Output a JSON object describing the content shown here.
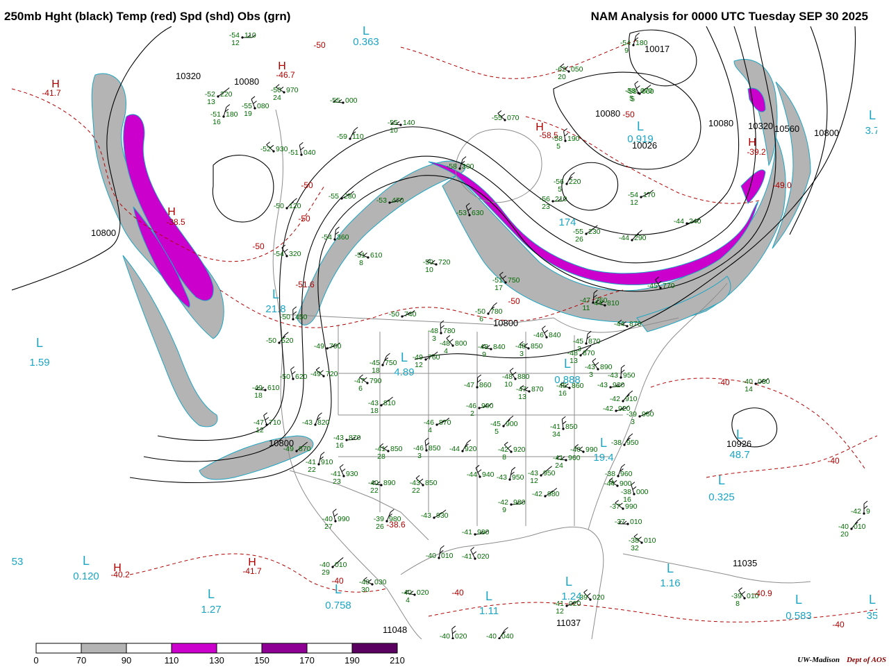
{
  "header": {
    "left_title": "250mb Hght (black) Temp (red) Spd (shd) Obs (grn)",
    "right_title": "NAM Analysis for 0000 UTC Tuesday  SEP 30 2025"
  },
  "colors": {
    "height_contour": "#000000",
    "temperature_contour": "#b00000",
    "boundaries": "#8c8c8c",
    "obs": "#006b00",
    "pressure_center_low": "#1ba5c4",
    "pressure_center_high": "#b00000",
    "speed_70_90": "#b4b4b4",
    "speed_110_130": "#cc00cc",
    "speed_150_170": "#8e0094",
    "speed_190_210": "#5a0060"
  },
  "legend": {
    "tick_labels": [
      "0",
      "70",
      "90",
      "110",
      "130",
      "150",
      "170",
      "190",
      "210"
    ],
    "bins": [
      {
        "from": 0,
        "to": 70,
        "color": "#ffffff"
      },
      {
        "from": 70,
        "to": 90,
        "color": "#b4b4b4"
      },
      {
        "from": 90,
        "to": 110,
        "color": "#ffffff"
      },
      {
        "from": 110,
        "to": 130,
        "color": "#cc00cc"
      },
      {
        "from": 130,
        "to": 150,
        "color": "#ffffff"
      },
      {
        "from": 150,
        "to": 170,
        "color": "#8e0094"
      },
      {
        "from": 170,
        "to": 190,
        "color": "#ffffff"
      },
      {
        "from": 190,
        "to": 210,
        "color": "#5a0060"
      }
    ]
  },
  "credit": {
    "org": "UW-Madison",
    "dept": "Dept of AOS"
  },
  "height_labels": [
    "10320",
    "10080",
    "10800",
    "10800",
    "10800",
    "10080",
    "10320",
    "10560",
    "10800",
    "10080",
    "10017",
    "10026",
    "10926",
    "11048",
    "11037",
    "11035"
  ],
  "pressure_centers": [
    {
      "type": "L",
      "value": "0.363"
    },
    {
      "type": "L",
      "value": "1.59"
    },
    {
      "type": "L",
      "value": "21.8"
    },
    {
      "type": "L",
      "value": "4.89"
    },
    {
      "type": "L",
      "value": "0.888"
    },
    {
      "type": "L",
      "value": "19.4"
    },
    {
      "type": "L",
      "value": "48.7"
    },
    {
      "type": "L",
      "value": "0.325"
    },
    {
      "type": "L",
      "value": "0.120"
    },
    {
      "type": "L",
      "value": "1.27"
    },
    {
      "type": "L",
      "value": "0.758"
    },
    {
      "type": "L",
      "value": "1.11"
    },
    {
      "type": "L",
      "value": "1.24"
    },
    {
      "type": "L",
      "value": "1.16"
    },
    {
      "type": "L",
      "value": "0.583"
    },
    {
      "type": "L",
      "value": "0.919"
    },
    {
      "type": "L",
      "value": "174"
    },
    {
      "type": "L",
      "value": "3.7"
    },
    {
      "type": "L",
      "value": "35"
    },
    {
      "type": "L",
      "value": "53"
    },
    {
      "type": "H",
      "value": "-41.7"
    },
    {
      "type": "H",
      "value": "-46.7"
    },
    {
      "type": "H",
      "value": "-38.5"
    },
    {
      "type": "H",
      "value": "-58.5"
    },
    {
      "type": "H",
      "value": "-39.2"
    },
    {
      "type": "H",
      "value": "-49.0"
    },
    {
      "type": "H",
      "value": "-51.6"
    },
    {
      "type": "H",
      "value": "-38.6"
    },
    {
      "type": "H",
      "value": "-40.2"
    },
    {
      "type": "H",
      "value": "-41.7"
    },
    {
      "type": "H",
      "value": "-40.9"
    }
  ],
  "temp_labels": [
    "-50",
    "-50",
    "-50",
    "-50",
    "-50",
    "-50",
    "-40",
    "-40",
    "-40",
    "-40",
    "-40"
  ],
  "observations": [
    {
      "t": "-54",
      "h": "110",
      "d": "12"
    },
    {
      "t": "-52",
      "h": "220",
      "d": "13"
    },
    {
      "t": "-51",
      "h": "180",
      "d": "16"
    },
    {
      "t": "-55",
      "h": "080",
      "d": "19"
    },
    {
      "t": "-50",
      "h": "970",
      "d": "24"
    },
    {
      "t": "-55",
      "h": "000",
      "d": ""
    },
    {
      "t": "-52",
      "h": "930",
      "d": ""
    },
    {
      "t": "-51",
      "h": "040",
      "d": ""
    },
    {
      "t": "-59",
      "h": "110",
      "d": ""
    },
    {
      "t": "-55",
      "h": "280",
      "d": ""
    },
    {
      "t": "-53",
      "h": "470",
      "d": ""
    },
    {
      "t": "-50",
      "h": "120",
      "d": ""
    },
    {
      "t": "-54",
      "h": "360",
      "d": ""
    },
    {
      "t": "-54",
      "h": "320",
      "d": ""
    },
    {
      "t": "-51",
      "h": "610",
      "d": "8"
    },
    {
      "t": "-50",
      "h": "720",
      "d": "10"
    },
    {
      "t": "-51",
      "h": "750",
      "d": "17"
    },
    {
      "t": "-50",
      "h": "450",
      "d": ""
    },
    {
      "t": "-50",
      "h": "520",
      "d": ""
    },
    {
      "t": "-49",
      "h": "700",
      "d": ""
    },
    {
      "t": "-50",
      "h": "740",
      "d": ""
    },
    {
      "t": "-50",
      "h": "780",
      "d": "6"
    },
    {
      "t": "-48",
      "h": "780",
      "d": "3"
    },
    {
      "t": "-48",
      "h": "800",
      "d": "4"
    },
    {
      "t": "-48",
      "h": "840",
      "d": "9"
    },
    {
      "t": "-48",
      "h": "850",
      "d": "3"
    },
    {
      "t": "-46",
      "h": "840",
      "d": ""
    },
    {
      "t": "-45",
      "h": "870",
      "d": "3"
    },
    {
      "t": "-48",
      "h": "870",
      "d": "13"
    },
    {
      "t": "-43",
      "h": "920",
      "d": ""
    },
    {
      "t": "-49",
      "h": "760",
      "d": "12"
    },
    {
      "t": "-45",
      "h": "750",
      "d": "18"
    },
    {
      "t": "-50",
      "h": "620",
      "d": ""
    },
    {
      "t": "-49",
      "h": "720",
      "d": ""
    },
    {
      "t": "-49",
      "h": "610",
      "d": "18"
    },
    {
      "t": "-47",
      "h": "790",
      "d": "6"
    },
    {
      "t": "-47",
      "h": "710",
      "d": "12"
    },
    {
      "t": "-43",
      "h": "820",
      "d": ""
    },
    {
      "t": "-43",
      "h": "810",
      "d": "18"
    },
    {
      "t": "-43",
      "h": "870",
      "d": "16"
    },
    {
      "t": "-49",
      "h": "870",
      "d": ""
    },
    {
      "t": "-41",
      "h": "910",
      "d": "22"
    },
    {
      "t": "-41",
      "h": "930",
      "d": "23"
    },
    {
      "t": "-41",
      "h": "850",
      "d": "28"
    },
    {
      "t": "-40",
      "h": "890",
      "d": "22"
    },
    {
      "t": "-43",
      "h": "850",
      "d": "22"
    },
    {
      "t": "-46",
      "h": "850",
      "d": "3"
    },
    {
      "t": "-44",
      "h": "920",
      "d": ""
    },
    {
      "t": "-46",
      "h": "870",
      "d": "4"
    },
    {
      "t": "-46",
      "h": "900",
      "d": "2"
    },
    {
      "t": "-45",
      "h": "900",
      "d": "5"
    },
    {
      "t": "-47",
      "h": "860",
      "d": ""
    },
    {
      "t": "-48",
      "h": "880",
      "d": "10"
    },
    {
      "t": "-47",
      "h": "870",
      "d": "13"
    },
    {
      "t": "-45",
      "h": "860",
      "d": "16"
    },
    {
      "t": "-43",
      "h": "890",
      "d": "3"
    },
    {
      "t": "-43",
      "h": "950",
      "d": ""
    },
    {
      "t": "-42",
      "h": "910",
      "d": ""
    },
    {
      "t": "-42",
      "h": "920",
      "d": ""
    },
    {
      "t": "-39",
      "h": "960",
      "d": "3"
    },
    {
      "t": "-38",
      "h": "950",
      "d": ""
    },
    {
      "t": "-41",
      "h": "850",
      "d": "34"
    },
    {
      "t": "-42",
      "h": "920",
      "d": "8"
    },
    {
      "t": "-41",
      "h": "960",
      "d": "24"
    },
    {
      "t": "-40",
      "h": "990",
      "d": ""
    },
    {
      "t": "-44",
      "h": "940",
      "d": ""
    },
    {
      "t": "-43",
      "h": "950",
      "d": ""
    },
    {
      "t": "-43",
      "h": "950",
      "d": "12"
    },
    {
      "t": "-42",
      "h": "980",
      "d": "9"
    },
    {
      "t": "-42",
      "h": "980",
      "d": ""
    },
    {
      "t": "-38",
      "h": "960",
      "d": "9"
    },
    {
      "t": "-38",
      "h": "000",
      "d": "16"
    },
    {
      "t": "-37",
      "h": "990",
      "d": ""
    },
    {
      "t": "-37",
      "h": "010",
      "d": ""
    },
    {
      "t": "-38",
      "h": "010",
      "d": "32"
    },
    {
      "t": "-40",
      "h": "990",
      "d": "27"
    },
    {
      "t": "-39",
      "h": "980",
      "d": "26"
    },
    {
      "t": "-43",
      "h": "930",
      "d": ""
    },
    {
      "t": "-41",
      "h": "990",
      "d": ""
    },
    {
      "t": "-40",
      "h": "010",
      "d": "29"
    },
    {
      "t": "-40",
      "h": "010",
      "d": ""
    },
    {
      "t": "-41",
      "h": "020",
      "d": ""
    },
    {
      "t": "-40",
      "h": "030",
      "d": "30"
    },
    {
      "t": "-40",
      "h": "020",
      "d": "4"
    },
    {
      "t": "-39",
      "h": "020",
      "d": ""
    },
    {
      "t": "-40",
      "h": "020",
      "d": ""
    },
    {
      "t": "-40",
      "h": "040",
      "d": "5"
    },
    {
      "t": "-41",
      "h": "020",
      "d": "12"
    },
    {
      "t": "-40",
      "h": "030",
      "d": "14"
    },
    {
      "t": "-40",
      "h": "010",
      "d": "20"
    },
    {
      "t": "-42",
      "h": "9",
      "d": ""
    },
    {
      "t": "-39",
      "h": "010",
      "d": "8"
    },
    {
      "t": "-44",
      "h": "810",
      "d": ""
    },
    {
      "t": "-44",
      "h": "870",
      "d": ""
    },
    {
      "t": "-45",
      "h": "770",
      "d": ""
    },
    {
      "t": "-47",
      "h": "750",
      "d": "11"
    },
    {
      "t": "-44",
      "h": "290",
      "d": ""
    },
    {
      "t": "-44",
      "h": "240",
      "d": ""
    },
    {
      "t": "-54",
      "h": "170",
      "d": "12"
    },
    {
      "t": "-56",
      "h": "220",
      "d": "5"
    },
    {
      "t": "-58",
      "h": "190",
      "d": "5"
    },
    {
      "t": "-55",
      "h": "070",
      "d": ""
    },
    {
      "t": "-55",
      "h": "140",
      "d": "10"
    },
    {
      "t": "-62",
      "h": "050",
      "d": "20"
    },
    {
      "t": "-58",
      "h": "070",
      "d": "5"
    },
    {
      "t": "-54",
      "h": "180",
      "d": "9"
    },
    {
      "t": "-58",
      "h": "060",
      "d": "5"
    },
    {
      "t": "-56",
      "h": "210",
      "d": "23"
    },
    {
      "t": "-55",
      "h": "230",
      "d": "26"
    },
    {
      "t": "-58",
      "h": "300",
      "d": ""
    },
    {
      "t": "-53",
      "h": "630",
      "d": ""
    },
    {
      "t": "-44",
      "h": "900",
      "d": ""
    }
  ]
}
